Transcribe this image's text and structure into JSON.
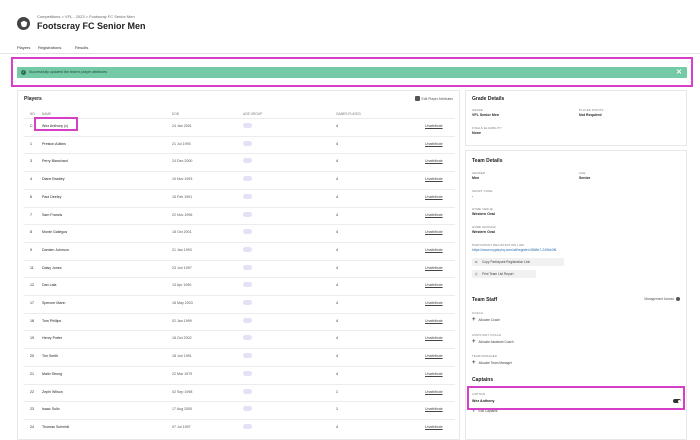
{
  "header": {
    "breadcrumb": "Competitions > VFL - 2023 > Footscray FC Senior Men",
    "title": "Footscray FC Senior Men"
  },
  "tabs": [
    "Players",
    "Registrations",
    "Results"
  ],
  "banner": {
    "message": "Successfully updated the team's player attributes",
    "close": "✕"
  },
  "players": {
    "title": "Players",
    "edit_label": "Edit Player Attributes",
    "columns": [
      "NO.",
      "NAME",
      "DOB",
      "AGE GROUP",
      "GAMES PLAYED",
      ""
    ],
    "link_label": "Unattribute",
    "rows": [
      {
        "no": "C",
        "name": "Wez Anthony (c)",
        "dob": "24 Jan 2001",
        "games": "4"
      },
      {
        "no": "1",
        "name": "Preston Adkins",
        "dob": "21 Jul 1993",
        "games": "4"
      },
      {
        "no": "3",
        "name": "Perry Blanchard",
        "dob": "24 Dec 2000",
        "games": "4"
      },
      {
        "no": "4",
        "name": "Diane Bradley",
        "dob": "10 Nov 1993",
        "games": "4"
      },
      {
        "no": "6",
        "name": "Paul Deeley",
        "dob": "15 Feb 1991",
        "games": "4"
      },
      {
        "no": "7",
        "name": "Sam Francis",
        "dob": "22 Nov 1996",
        "games": "4"
      },
      {
        "no": "8",
        "name": "Monte Gallegos",
        "dob": "18 Oct 2001",
        "games": "4"
      },
      {
        "no": "9",
        "name": "Damien Johnson",
        "dob": "21 Jan 1993",
        "games": "4"
      },
      {
        "no": "11",
        "name": "Daisy Jones",
        "dob": "23 Jun 1997",
        "games": "4"
      },
      {
        "no": "12",
        "name": "Dan Lala",
        "dob": "13 Apr 1990",
        "games": "4"
      },
      {
        "no": "17",
        "name": "Spencer Marin",
        "dob": "18 May 2003",
        "games": "4"
      },
      {
        "no": "18",
        "name": "Tom Phillips",
        "dob": "02 Jan 1999",
        "games": "4"
      },
      {
        "no": "19",
        "name": "Henry Potter",
        "dob": "18 Oct 2002",
        "games": "4"
      },
      {
        "no": "20",
        "name": "Tim Smith",
        "dob": "18 Jun 1991",
        "games": "4"
      },
      {
        "no": "21",
        "name": "Malin Strong",
        "dob": "22 Mar 1979",
        "games": "4"
      },
      {
        "no": "22",
        "name": "Zephi Wilson",
        "dob": "02 Sep 1998",
        "games": "1"
      },
      {
        "no": "23",
        "name": "Isaac Sullo",
        "dob": "17 Aug 2000",
        "games": "1"
      },
      {
        "no": "24",
        "name": "Thomas Schmidt",
        "dob": "07 Jul 1997",
        "games": "4"
      }
    ]
  },
  "grade_details": {
    "title": "Grade Details",
    "grade_label": "GRADE",
    "grade_value": "VFL Senior Men",
    "player_points_label": "PLAYER POINTS",
    "player_points_value": "Not Required",
    "finals_label": "FINALS ELIGIBILITY",
    "finals_value": "None"
  },
  "team_details": {
    "title": "Team Details",
    "gender_label": "GENDER",
    "gender_value": "Men",
    "age_label": "AGE",
    "age_value": "Senior",
    "short_code_label": "SHORT CODE",
    "short_code_value": "-",
    "home_venue_label": "HOME VENUE",
    "home_venue_value": "Western Oval",
    "home_ground_label": "HOME GROUND",
    "home_ground_value": "Western Oval",
    "reg_link_label": "PARTICIPANT REGISTRATION LINK",
    "reg_link_value": "https://www.myplayhq.com/afl/register/4568e7-2456e2f6",
    "copy_btn": "Copy Participant Registration Link",
    "print_btn": "Print Team List Report"
  },
  "team_staff": {
    "title": "Team Staff",
    "mgmt_label": "Management Access",
    "coach_label": "COACH",
    "coach_add": "Allocate Coach",
    "asst_label": "ASSISTANT COACH",
    "asst_add": "Allocate Assistant Coach",
    "manager_label": "TEAM MANAGER",
    "manager_add": "Allocate Team Manager"
  },
  "captains": {
    "title": "Captains",
    "captain_label": "CAPTAIN",
    "captain_value": "Wez Anthony",
    "edit_label": "Edit Captains"
  }
}
